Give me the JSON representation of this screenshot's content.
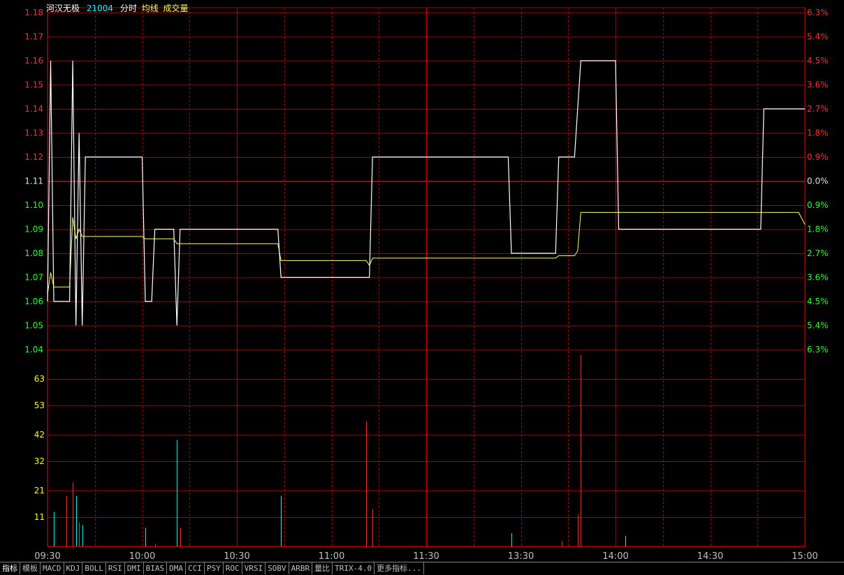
{
  "header": {
    "stock_name": "河汉无极",
    "code": "21004",
    "mode": "分时",
    "avg_label": "均线",
    "volume_label": "成交量"
  },
  "colors": {
    "grid": "#b00000",
    "price_line": "#ffffff",
    "avg_line": "#ffff66",
    "up": "#ff3030",
    "down": "#30ff30",
    "flat": "#e0e0e0",
    "vol_up": "#ff3030",
    "vol_down": "#00ffff",
    "vol_axis": "#ffff00"
  },
  "tabs": [
    "指标",
    "模板",
    "MACD",
    "KDJ",
    "BOLL",
    "RSI",
    "DMI",
    "BIAS",
    "DMA",
    "CCI",
    "PSY",
    "ROC",
    "VRSI",
    "SOBV",
    "ARBR",
    "量比",
    "TRIX-4.0",
    "更多指标..."
  ],
  "chart_data": [
    {
      "type": "line",
      "prev_close": 1.11,
      "ylim": [
        1.04,
        1.18
      ],
      "y_ticks": [
        {
          "v": 1.18,
          "pct": "6.3%"
        },
        {
          "v": 1.17,
          "pct": "5.4%"
        },
        {
          "v": 1.16,
          "pct": "4.5%"
        },
        {
          "v": 1.15,
          "pct": "3.6%"
        },
        {
          "v": 1.14,
          "pct": "2.7%"
        },
        {
          "v": 1.13,
          "pct": "1.8%"
        },
        {
          "v": 1.12,
          "pct": "0.9%"
        },
        {
          "v": 1.11,
          "pct": "0.0%"
        },
        {
          "v": 1.1,
          "pct": "0.9%"
        },
        {
          "v": 1.09,
          "pct": "1.8%"
        },
        {
          "v": 1.08,
          "pct": "2.7%"
        },
        {
          "v": 1.07,
          "pct": "3.6%"
        },
        {
          "v": 1.06,
          "pct": "4.5%"
        },
        {
          "v": 1.05,
          "pct": "5.4%"
        },
        {
          "v": 1.04,
          "pct": "6.3%"
        }
      ],
      "x_ticks": [
        "09:30",
        "10:00",
        "10:30",
        "11:00",
        "11:30",
        "13:30",
        "14:00",
        "14:30",
        "15:00"
      ],
      "x_range": [
        0,
        240
      ],
      "series": [
        {
          "points": [
            [
              0,
              1.06
            ],
            [
              1,
              1.16
            ],
            [
              2,
              1.06
            ],
            [
              7,
              1.06
            ],
            [
              8,
              1.16
            ],
            [
              9,
              1.05
            ],
            [
              10,
              1.13
            ],
            [
              11,
              1.05
            ],
            [
              12,
              1.12
            ],
            [
              30,
              1.12
            ],
            [
              31,
              1.06
            ],
            [
              33,
              1.06
            ],
            [
              34,
              1.09
            ],
            [
              40,
              1.09
            ],
            [
              41,
              1.05
            ],
            [
              42,
              1.09
            ],
            [
              73,
              1.09
            ],
            [
              74,
              1.07
            ],
            [
              102,
              1.07
            ],
            [
              103,
              1.12
            ],
            [
              146,
              1.12
            ],
            [
              147,
              1.08
            ],
            [
              161,
              1.08
            ],
            [
              162,
              1.12
            ],
            [
              167,
              1.12
            ],
            [
              169,
              1.16
            ],
            [
              180,
              1.16
            ],
            [
              181,
              1.09
            ],
            [
              226,
              1.09
            ],
            [
              227,
              1.14
            ],
            [
              240,
              1.14
            ]
          ]
        },
        {
          "points": [
            [
              0,
              1.063
            ],
            [
              1,
              1.072
            ],
            [
              2,
              1.066
            ],
            [
              7,
              1.066
            ],
            [
              8,
              1.095
            ],
            [
              9,
              1.086
            ],
            [
              10,
              1.09
            ],
            [
              11,
              1.087
            ],
            [
              12,
              1.087
            ],
            [
              30,
              1.087
            ],
            [
              31,
              1.086
            ],
            [
              33,
              1.086
            ],
            [
              34,
              1.086
            ],
            [
              40,
              1.086
            ],
            [
              41,
              1.084
            ],
            [
              42,
              1.084
            ],
            [
              73,
              1.084
            ],
            [
              74,
              1.077
            ],
            [
              101,
              1.077
            ],
            [
              102,
              1.075
            ],
            [
              103,
              1.078
            ],
            [
              146,
              1.078
            ],
            [
              147,
              1.078
            ],
            [
              161,
              1.078
            ],
            [
              162,
              1.079
            ],
            [
              167,
              1.079
            ],
            [
              168,
              1.081
            ],
            [
              169,
              1.097
            ],
            [
              180,
              1.097
            ],
            [
              181,
              1.097
            ],
            [
              226,
              1.097
            ],
            [
              238,
              1.097
            ],
            [
              240,
              1.092
            ]
          ]
        }
      ]
    },
    {
      "type": "bar",
      "y_ticks": [
        11,
        21,
        32,
        42,
        53,
        63
      ],
      "ylim": [
        0,
        74
      ],
      "bars": [
        {
          "t": 2,
          "v": 13,
          "dir": "down"
        },
        {
          "t": 6,
          "v": 19,
          "dir": "up"
        },
        {
          "t": 8,
          "v": 24,
          "dir": "up"
        },
        {
          "t": 9,
          "v": 19,
          "dir": "down"
        },
        {
          "t": 10,
          "v": 9,
          "dir": "up"
        },
        {
          "t": 11,
          "v": 8,
          "dir": "down"
        },
        {
          "t": 31,
          "v": 7,
          "dir": "down"
        },
        {
          "t": 34,
          "v": 1,
          "dir": "up"
        },
        {
          "t": 41,
          "v": 40,
          "dir": "down"
        },
        {
          "t": 42,
          "v": 7,
          "dir": "up"
        },
        {
          "t": 74,
          "v": 19,
          "dir": "down"
        },
        {
          "t": 101,
          "v": 47,
          "dir": "up"
        },
        {
          "t": 103,
          "v": 14,
          "dir": "up"
        },
        {
          "t": 147,
          "v": 5,
          "dir": "down"
        },
        {
          "t": 163,
          "v": 2,
          "dir": "up"
        },
        {
          "t": 168,
          "v": 12,
          "dir": "up"
        },
        {
          "t": 169,
          "v": 72,
          "dir": "up"
        },
        {
          "t": 183,
          "v": 4,
          "dir": "down"
        }
      ]
    }
  ]
}
